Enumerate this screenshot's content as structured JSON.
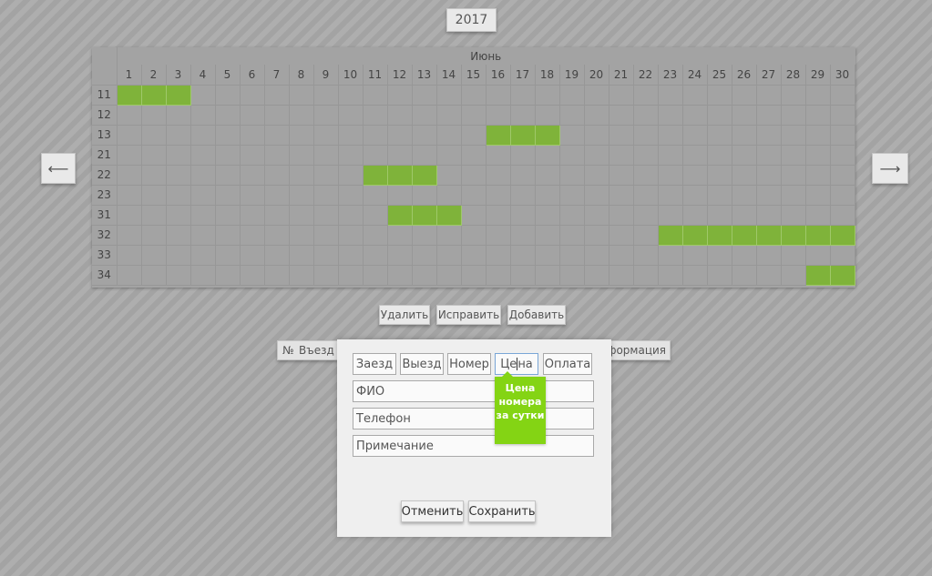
{
  "year": "2017",
  "nav": {
    "prev": "⟵",
    "next": "⟶"
  },
  "calendar": {
    "month": "Июнь",
    "days": [
      "1",
      "2",
      "3",
      "4",
      "5",
      "6",
      "7",
      "8",
      "9",
      "10",
      "11",
      "12",
      "13",
      "14",
      "15",
      "16",
      "17",
      "18",
      "19",
      "20",
      "21",
      "22",
      "23",
      "24",
      "25",
      "26",
      "27",
      "28",
      "29",
      "30"
    ],
    "rooms": [
      {
        "number": "11",
        "booked_days": [
          1,
          2,
          3
        ]
      },
      {
        "number": "12",
        "booked_days": []
      },
      {
        "number": "13",
        "booked_days": [
          16,
          17,
          18
        ]
      },
      {
        "number": "21",
        "booked_days": []
      },
      {
        "number": "22",
        "booked_days": [
          11,
          12,
          13
        ]
      },
      {
        "number": "23",
        "booked_days": []
      },
      {
        "number": "31",
        "booked_days": [
          12,
          13,
          14
        ]
      },
      {
        "number": "32",
        "booked_days": [
          23,
          24,
          25,
          26,
          27,
          28,
          29,
          30
        ]
      },
      {
        "number": "33",
        "booked_days": []
      },
      {
        "number": "34",
        "booked_days": [
          29,
          30
        ]
      }
    ],
    "booked_color": "#7fb33a"
  },
  "actions": {
    "delete": "Удалить",
    "edit": "Исправить",
    "add": "Добавить"
  },
  "table_header": {
    "num": "№",
    "exit": "Въезд",
    "info": "формация"
  },
  "modal": {
    "checkin_placeholder": "Заезд",
    "checkout_placeholder": "Выезд",
    "room_placeholder": "Номер",
    "price_value": "Цена",
    "payment_placeholder": "Оплата",
    "fio_placeholder": "ФИО",
    "phone_placeholder": "Телефон",
    "note_placeholder": "Примечание",
    "tooltip": "Цена номера за сутки",
    "cancel": "Отменить",
    "save": "Сохранить"
  },
  "colors": {
    "tooltip": "#84d414",
    "background": "#a6a6a6"
  }
}
